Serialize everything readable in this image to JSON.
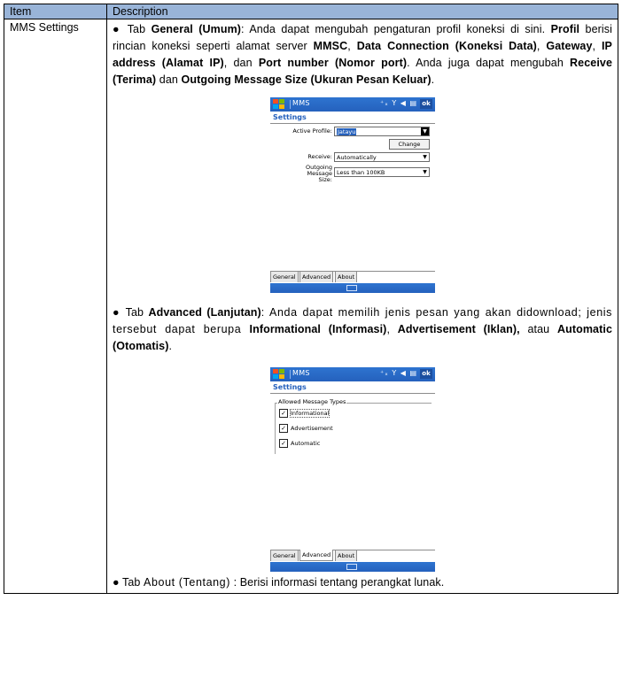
{
  "table": {
    "header": {
      "item": "Item",
      "description": "Description"
    },
    "row": {
      "item": "MMS Settings",
      "general": {
        "bullet": "●",
        "p1_pre": "Tab ",
        "p1_b1": "General (Umum)",
        "p1_t1": ": Anda dapat mengubah pengaturan profil koneksi di sini. ",
        "p1_b2": "Profil",
        "p1_t2": " berisi rincian koneksi seperti alamat server ",
        "p1_b3": "MMSC",
        "p1_t3": ", ",
        "p1_b4": "Data Connection (Koneksi Data)",
        "p1_t4": ", ",
        "p1_b5": "Gateway",
        "p1_t5": ", ",
        "p1_b6": "IP address (Alamat IP)",
        "p1_t6": ", dan ",
        "p1_b7": "Port number (Nomor port)",
        "p1_t7": ". Anda juga dapat mengubah ",
        "p1_b8": "Receive (Terima)",
        "p1_t8": " dan ",
        "p1_b9": "Outgoing Message Size (Ukuran Pesan Keluar)",
        "p1_t9": "."
      },
      "advanced": {
        "bullet": "●",
        "p_pre": "Tab ",
        "p_b1": "Advanced (Lanjutan)",
        "p_t1": ": Anda dapat memilih jenis pesan yang akan didownload; jenis tersebut dapat berupa ",
        "p_b2": "Informational (Informasi)",
        "p_t2": ", ",
        "p_b3": "Advertisement (Iklan),",
        "p_t3": " atau ",
        "p_b4": "Automatic (Otomatis)",
        "p_t4": "."
      },
      "about": {
        "bullet": "●",
        "pre": "Tab ",
        "label": "About (Tentang)",
        "text": " : Berisi informasi tentang perangkat lunak."
      }
    }
  },
  "screen1": {
    "app": "MMS",
    "status": "⁺ₓ Y ◀ ▤",
    "ok": "ok",
    "title": "Settings",
    "active_profile_label": "Active Profile:",
    "active_profile_value": "Jatayu",
    "change_button": "Change",
    "receive_label": "Receive:",
    "receive_value": "Automatically",
    "outgoing_label_1": "Outgoing Message",
    "outgoing_label_2": "Size:",
    "outgoing_value": "Less than 100KB",
    "tabs": [
      "General",
      "Advanced",
      "About"
    ]
  },
  "screen2": {
    "app": "MMS",
    "status": "⁺ₓ Y ◀ ▤",
    "ok": "ok",
    "title": "Settings",
    "group_label": "Allowed Message Types",
    "options": [
      "Informational",
      "Advertisement",
      "Automatic"
    ],
    "tabs": [
      "General",
      "Advanced",
      "About"
    ]
  },
  "colors": {
    "header_bg": "#99b4d8",
    "titlebar": "#2561bd"
  }
}
